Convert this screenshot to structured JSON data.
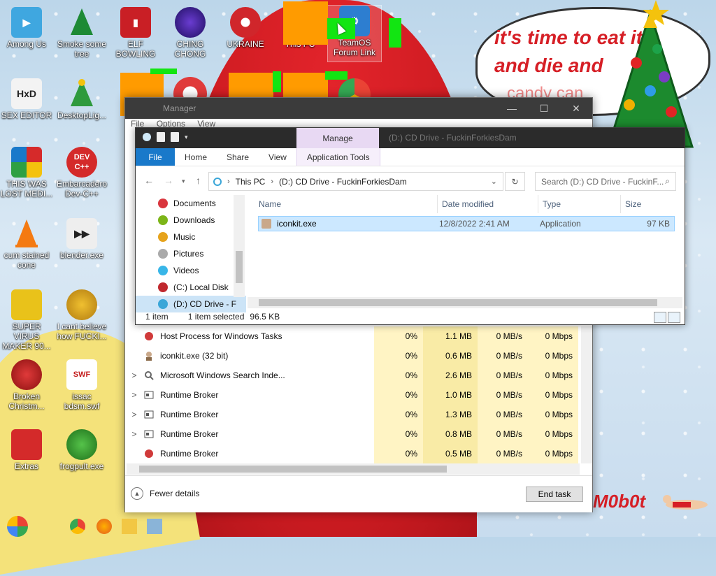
{
  "wallpaper": {
    "bubble_line1": "it's time to eat",
    "bubble_fragment1": "it",
    "bubble_line2": "and die and",
    "bubble_line3": "candy can",
    "signature": "M0b0t"
  },
  "desktop": {
    "icons": [
      {
        "label": "Among Us"
      },
      {
        "label": "Smoke some tree"
      },
      {
        "label": "ELF BOWLING"
      },
      {
        "label": "CHING CHONG"
      },
      {
        "label": "UKRAINE"
      },
      {
        "label": "This PC"
      },
      {
        "label": "TeamOS Forum Link"
      },
      {
        "label": "SEX EDITOR"
      },
      {
        "label": "DesktopLig..."
      },
      {
        "label": "THIS WAS LOST MEDI..."
      },
      {
        "label": "Embarcadero Dev-C++"
      },
      {
        "label": "cum stained cone"
      },
      {
        "label": "blender.exe"
      },
      {
        "label": "SUPER VIRUS MAKER 90..."
      },
      {
        "label": "I cant believe how FUCKI..."
      },
      {
        "label": "Broken Christm..."
      },
      {
        "label": "issac bdsm.swf"
      },
      {
        "label": "Extras"
      },
      {
        "label": "frogpult.exe"
      }
    ],
    "icon_devcpp_text": "DEV C++",
    "icon_swf_text": "SWF",
    "icon_hxd_text": "HxD"
  },
  "task_manager": {
    "title": "Manager",
    "menu": [
      "File",
      "Options",
      "View"
    ],
    "processes": [
      {
        "name": "Host Process for Windows Tasks",
        "expand": "",
        "cpu": "0%",
        "memory": "1.1 MB",
        "disk": "0 MB/s",
        "network": "0 Mbps"
      },
      {
        "name": "iconkit.exe (32 bit)",
        "expand": "",
        "cpu": "0%",
        "memory": "0.6 MB",
        "disk": "0 MB/s",
        "network": "0 Mbps"
      },
      {
        "name": "Microsoft Windows Search Inde...",
        "expand": ">",
        "cpu": "0%",
        "memory": "2.6 MB",
        "disk": "0 MB/s",
        "network": "0 Mbps"
      },
      {
        "name": "Runtime Broker",
        "expand": ">",
        "cpu": "0%",
        "memory": "1.0 MB",
        "disk": "0 MB/s",
        "network": "0 Mbps"
      },
      {
        "name": "Runtime Broker",
        "expand": ">",
        "cpu": "0%",
        "memory": "1.3 MB",
        "disk": "0 MB/s",
        "network": "0 Mbps"
      },
      {
        "name": "Runtime Broker",
        "expand": ">",
        "cpu": "0%",
        "memory": "0.8 MB",
        "disk": "0 MB/s",
        "network": "0 Mbps"
      },
      {
        "name": "Runtime Broker",
        "expand": "",
        "cpu": "0%",
        "memory": "0.5 MB",
        "disk": "0 MB/s",
        "network": "0 Mbps"
      }
    ],
    "fewer_details": "Fewer details",
    "end_task": "End task"
  },
  "explorer": {
    "manage_tab": "Manage",
    "title": "(D:) CD Drive - FuckinForkiesDam",
    "ribbon": {
      "file": "File",
      "home": "Home",
      "share": "Share",
      "view": "View",
      "app_tools": "Application Tools"
    },
    "address": {
      "seg1": "This PC",
      "seg2": "(D:) CD Drive - FuckinForkiesDam"
    },
    "search_placeholder": "Search (D:) CD Drive - FuckinF...",
    "nav_items": [
      {
        "label": "Documents",
        "color": "#d9363e"
      },
      {
        "label": "Downloads",
        "color": "#7cb518"
      },
      {
        "label": "Music",
        "color": "#e6a31c"
      },
      {
        "label": "Pictures",
        "color": "#aaaaaa"
      },
      {
        "label": "Videos",
        "color": "#38b6e8"
      },
      {
        "label": "(C:) Local Disk",
        "color": "#c0282e"
      },
      {
        "label": "(D:) CD Drive - F",
        "color": "#3aa6d8"
      }
    ],
    "columns": {
      "name": "Name",
      "date": "Date modified",
      "type": "Type",
      "size": "Size"
    },
    "files": [
      {
        "name": "iconkit.exe",
        "date": "12/8/2022 2:41 AM",
        "type": "Application",
        "size": "97 KB"
      }
    ],
    "status": {
      "count": "1 item",
      "selected": "1 item selected",
      "size": "96.5 KB"
    }
  },
  "colors": {
    "accent_blue": "#1979ca",
    "selection": "#cce8ff",
    "manage_tab": "#e8d9f3",
    "orange_block": "#ff9b00",
    "green_block": "#12e512"
  }
}
